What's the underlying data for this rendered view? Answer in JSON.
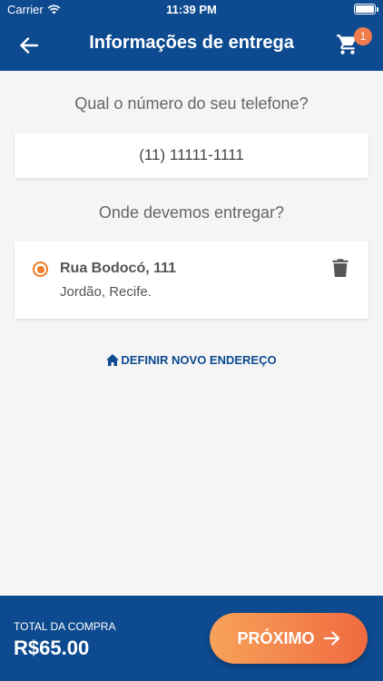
{
  "status_bar": {
    "carrier": "Carrier",
    "time": "11:39 PM"
  },
  "header": {
    "title": "Informações de entrega",
    "cart_count": "1"
  },
  "phone": {
    "question": "Qual o número do seu telefone?",
    "value": "(11) 11111-1111"
  },
  "delivery": {
    "question": "Onde devemos entregar?",
    "address": {
      "street": "Rua Bodocó, 111",
      "city": "Jordão, Recife.",
      "selected": true
    },
    "new_address_label": "DEFINIR NOVO ENDEREÇO"
  },
  "footer": {
    "total_label": "TOTAL DA COMPRA",
    "total_value": "R$65.00",
    "next_label": "PRÓXIMO"
  },
  "colors": {
    "primary": "#0d4a8f",
    "accent": "#f07b27",
    "background": "#f5f5f5"
  },
  "icons": [
    "wifi-icon",
    "battery-icon",
    "back-arrow-icon",
    "cart-icon",
    "radio-selected-icon",
    "trash-icon",
    "home-icon",
    "arrow-right-icon"
  ]
}
